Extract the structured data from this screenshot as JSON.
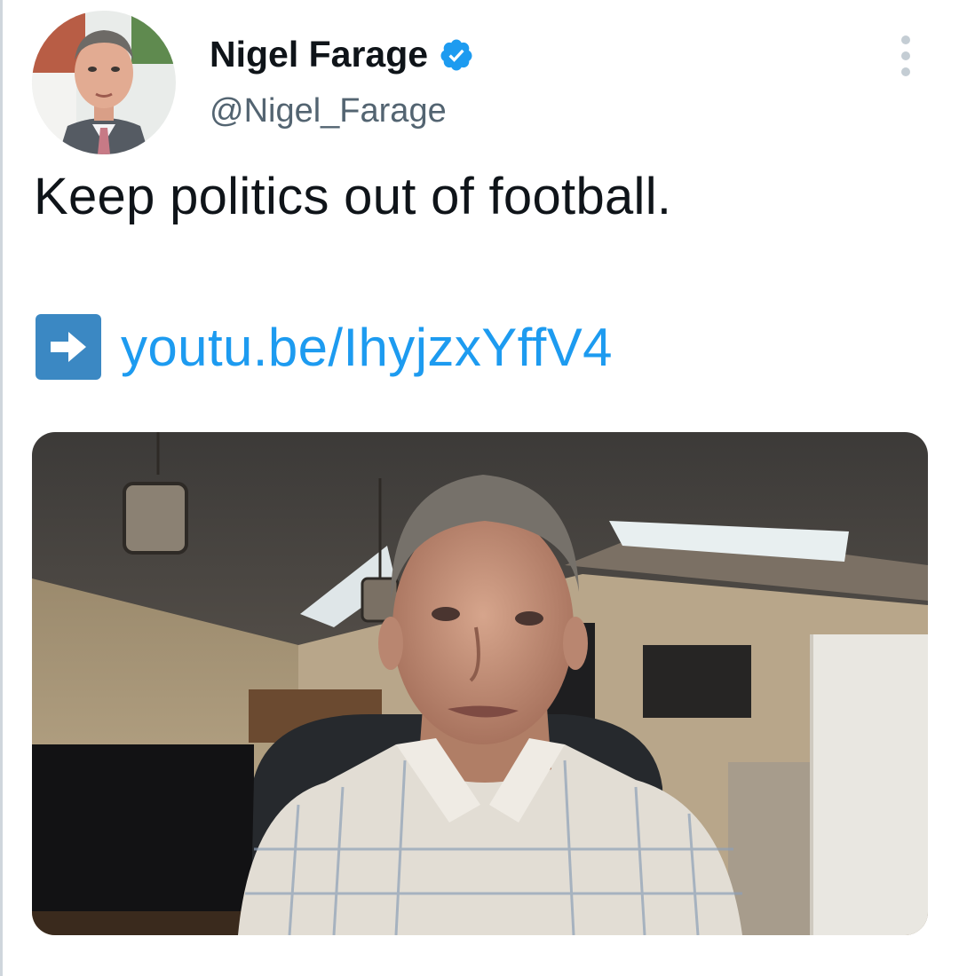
{
  "author": {
    "display_name": "Nigel Farage",
    "handle": "@Nigel_Farage",
    "verified": true,
    "verified_icon": "verified-badge-icon",
    "avatar_icon": "profile-photo"
  },
  "tweet": {
    "text": "Keep politics out of football.",
    "link_prefix_icon": "right-arrow-emoji-icon",
    "link_text": "youtu.be/IhyjzxYffV4"
  },
  "media": {
    "type": "video-thumbnail",
    "description_icon": "video-still-man-in-room"
  },
  "actions": {
    "more_icon": "more-options-icon"
  },
  "colors": {
    "link": "#1d9bf0",
    "verified": "#1d9bf0",
    "text_primary": "#0f1419",
    "text_secondary": "#536471",
    "arrow_box": "#3b88c3"
  }
}
